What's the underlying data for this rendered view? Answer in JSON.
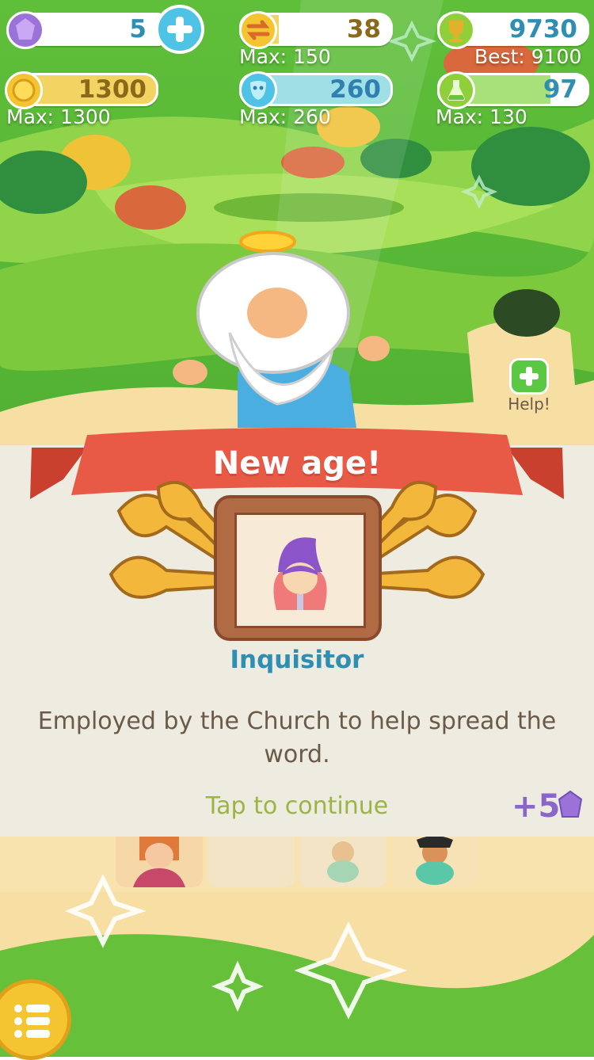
{
  "hud": {
    "gems": {
      "value": "5"
    },
    "swaps": {
      "value": "38",
      "max_label": "Max: 150",
      "level": 0.25
    },
    "trophy": {
      "value": "9730",
      "best_label": "Best: 9100"
    },
    "coins": {
      "value": "1300",
      "max_label": "Max: 1300",
      "level": 1.0
    },
    "faith": {
      "value": "260",
      "max_label": "Max: 260",
      "level": 1.0
    },
    "potion": {
      "value": "97",
      "max_label": "Max: 130",
      "level": 0.75
    }
  },
  "help": {
    "label": "Help!"
  },
  "popup": {
    "banner": "New age!",
    "unit_name": "Inquisitor",
    "description": "Employed by the Church to help spread the word.",
    "continue_label": "Tap to continue",
    "reward": "+5"
  },
  "icons": {
    "gem": "gem-icon",
    "add": "plus-icon",
    "swap": "arrows-icon",
    "trophy": "trophy-icon",
    "coin": "coin-icon",
    "mask": "mask-icon",
    "potion": "flask-icon",
    "menu": "menu-icon"
  },
  "colors": {
    "banner": "#e85a45",
    "title": "#2f8fb3",
    "continue": "#9bb545",
    "reward": "#8b66c9",
    "panel": "#eeebe0"
  }
}
